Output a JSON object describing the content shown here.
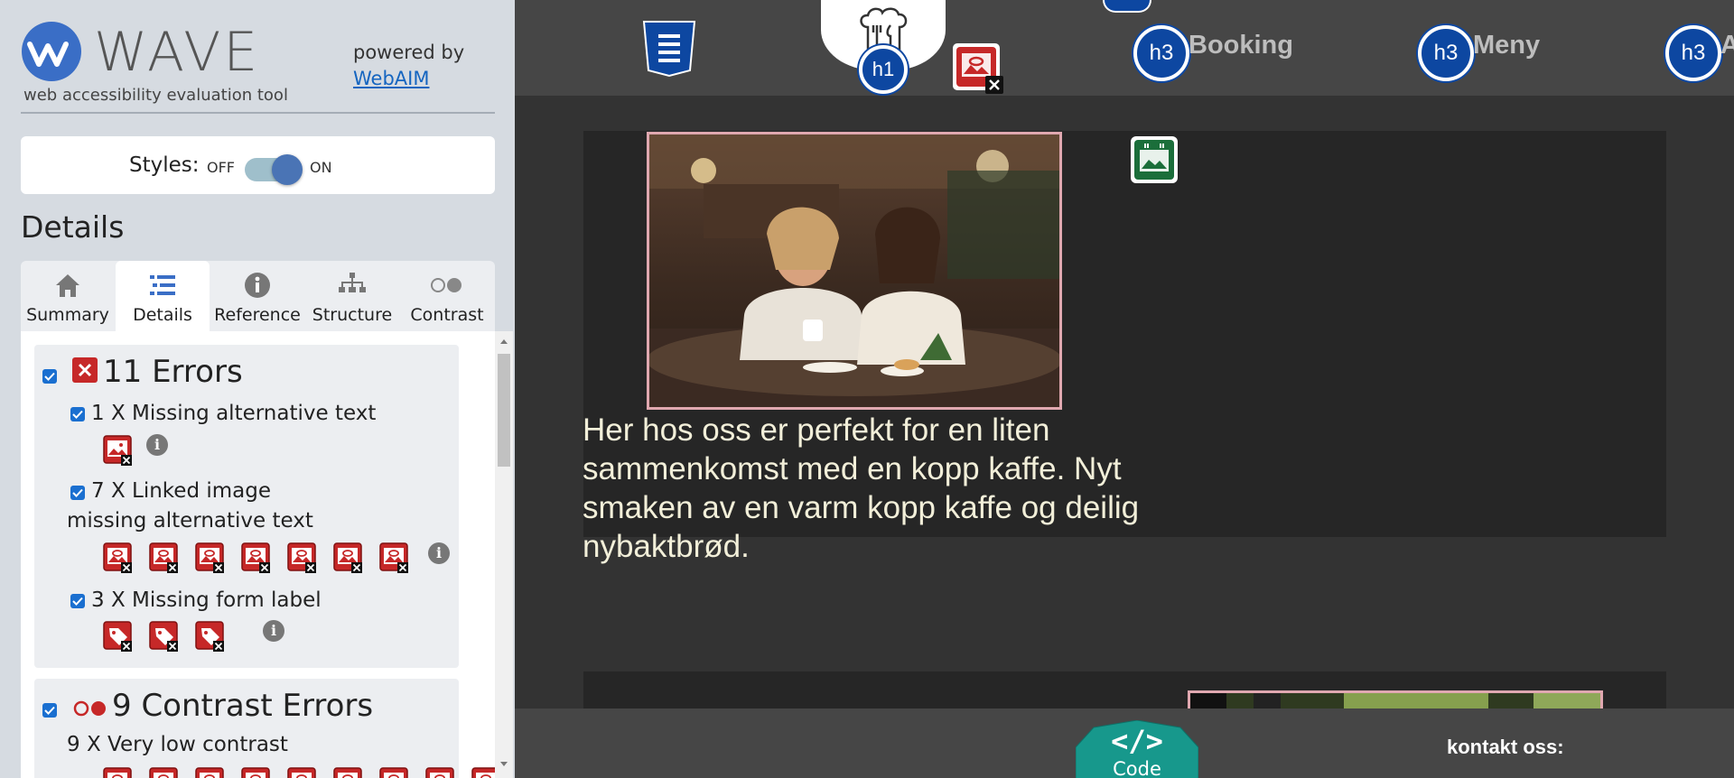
{
  "sidebar": {
    "logo_text": "WAVE",
    "tagline": "web accessibility evaluation tool",
    "powered_by": "powered by",
    "webaim_link": "WebAIM",
    "styles_label": "Styles:",
    "styles_off": "OFF",
    "styles_on": "ON",
    "details_heading": "Details",
    "tabs": [
      {
        "label": "Summary",
        "icon": "home-icon"
      },
      {
        "label": "Details",
        "icon": "list-icon",
        "active": true
      },
      {
        "label": "Reference",
        "icon": "info-icon"
      },
      {
        "label": "Structure",
        "icon": "hierarchy-icon"
      },
      {
        "label": "Contrast",
        "icon": "contrast-icon"
      }
    ],
    "errors": {
      "title": "11 Errors",
      "items": [
        {
          "label": "1 X Missing alternative text",
          "count": 1
        },
        {
          "label": "7 X Linked image missing alternative text",
          "count": 7
        },
        {
          "label": "3 X Missing form label",
          "count": 3
        }
      ]
    },
    "contrast": {
      "title": "9 Contrast Errors",
      "items": [
        {
          "label": "9 X Very low contrast",
          "count": 9
        }
      ]
    }
  },
  "page": {
    "nav": [
      {
        "tag": "h3",
        "label": "Booking"
      },
      {
        "tag": "h3",
        "label": "Meny"
      },
      {
        "tag": "h3",
        "label": "A"
      }
    ],
    "logo_heading_tag": "h1",
    "paragraph": "Her hos oss er perfekt for en liten sammenkomst med en kopp kaffe. Nyt smaken av en varm kopp kaffe og deilig nybaktbrød.",
    "footer_contact": "kontakt oss:",
    "code_button": "Code",
    "code_symbol": "</>"
  },
  "colors": {
    "error_red": "#c62828",
    "heading_blue": "#0d47a1",
    "alert_green": "#1b6e3a",
    "code_teal": "#17988c"
  }
}
